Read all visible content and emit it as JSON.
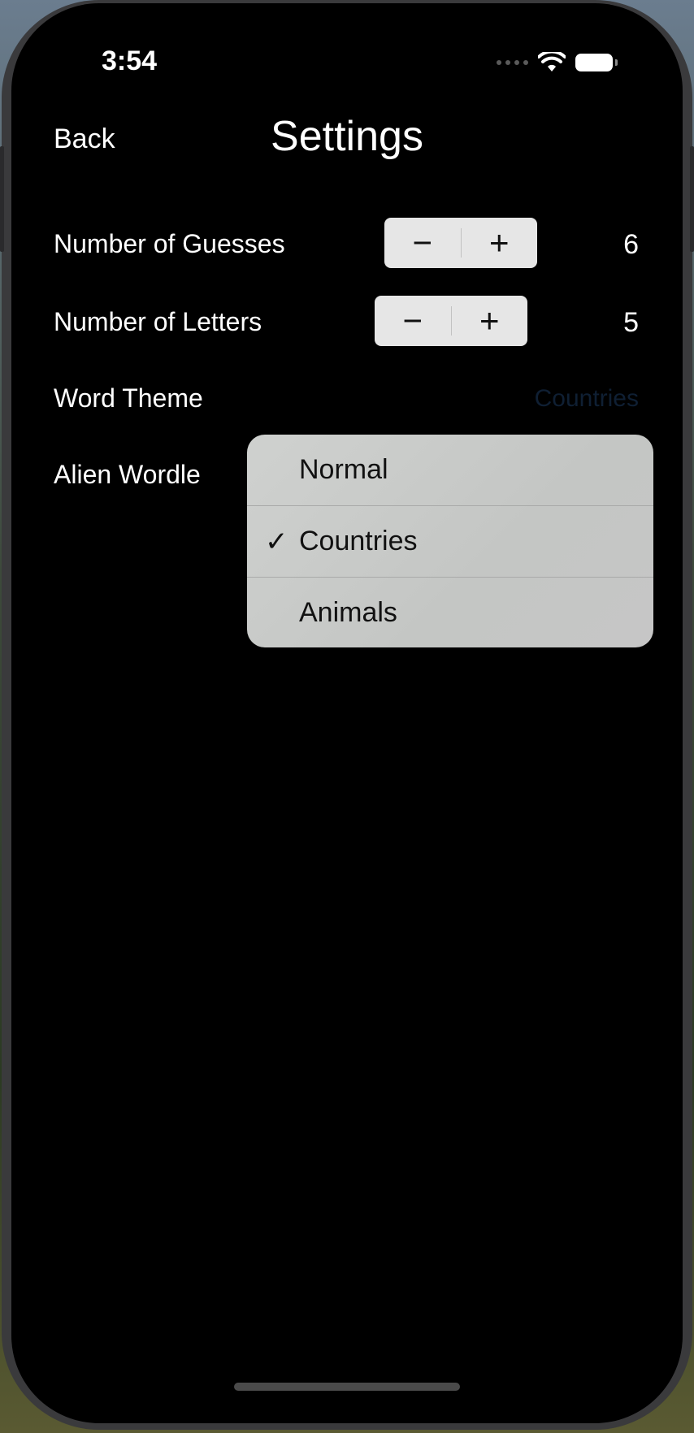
{
  "status_bar": {
    "time": "3:54"
  },
  "nav": {
    "back_label": "Back",
    "title": "Settings"
  },
  "settings": {
    "guesses": {
      "label": "Number of Guesses",
      "value": "6",
      "minus": "−",
      "plus": "+"
    },
    "letters": {
      "label": "Number of Letters",
      "value": "5",
      "minus": "−",
      "plus": "+"
    },
    "theme": {
      "label": "Word Theme",
      "value": "Countries"
    },
    "alien": {
      "label": "Alien Wordle"
    }
  },
  "theme_menu": {
    "items": [
      {
        "label": "Normal",
        "checked": false
      },
      {
        "label": "Countries",
        "checked": true
      },
      {
        "label": "Animals",
        "checked": false
      }
    ],
    "check_glyph": "✓"
  }
}
